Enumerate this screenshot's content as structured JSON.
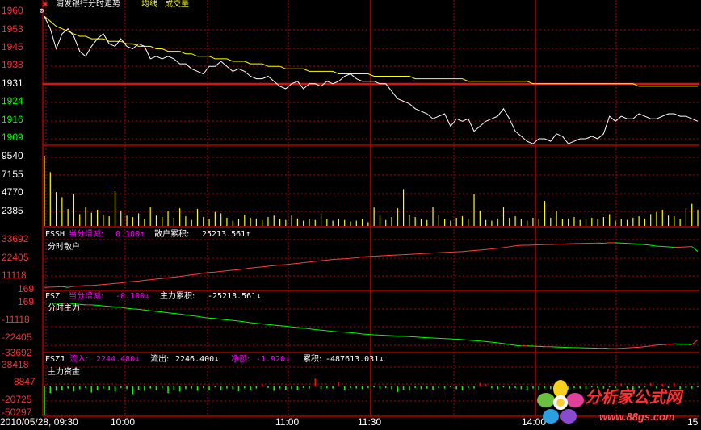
{
  "title_bar": {
    "stock_title": "浦发银行分时走势",
    "legend_avg": "均线",
    "legend_vol": "成交量"
  },
  "price_axis": [
    "1960",
    "1953",
    "1945",
    "1938",
    "1931",
    "1924",
    "1916",
    "1909"
  ],
  "volume_axis": [
    "9540",
    "7155",
    "4770",
    "2385"
  ],
  "panel_fssh": {
    "code": "FSSH",
    "inc_label": "当分增减:",
    "inc_value": "0.100↑",
    "cum_label": "散户累积:",
    "cum_value": "25213.561↑",
    "name": "分时散户",
    "axis": [
      "33692",
      "22405",
      "11118",
      "169"
    ]
  },
  "panel_fszl": {
    "code": "FSZL",
    "inc_label": "当分增减:",
    "inc_value": "-0.100↓",
    "cum_label": "主力累积:",
    "cum_value": "-25213.561↓",
    "name": "分时主力",
    "axis": [
      "169",
      "-11118",
      "-22405",
      "-33692"
    ]
  },
  "panel_fszj": {
    "code": "FSZJ",
    "in_label": "流入:",
    "in_value": "2244.480↓",
    "out_label": "流出:",
    "out_value": "2246.400↓",
    "net_label": "净额:",
    "net_value": "-1.920↓",
    "cum_label": "累积:",
    "cum_value": "-487613.031↓",
    "name": "主力资金",
    "axis": [
      "38418",
      "8847",
      "-20725",
      "-50297"
    ]
  },
  "time_axis": {
    "start": "2010/05/28, 09:30",
    "t1000": "10:00",
    "t1100": "11:00",
    "t1130": "11:30",
    "t1400": "14:00",
    "t1500": "15"
  },
  "watermark": {
    "name": "分析家公式网",
    "url": "www.88gs.com",
    "logo": "flower-logo"
  },
  "colors": {
    "grid": "#b40000",
    "price_line": "#ffffff",
    "avg_line": "#ffff00",
    "volume": "#ffff00",
    "axis_red": "#ff3030",
    "axis_green": "#00ff00",
    "ind_yellow": "#ffff00",
    "ind_magenta": "#ff00ff",
    "ind_white": "#ffffff",
    "ind_green": "#00ff00",
    "net_red": "#ff0000",
    "net_green": "#00ff00"
  },
  "chart_data": [
    {
      "type": "line",
      "name": "price",
      "y_axis_ticks": [
        1960,
        1953,
        1945,
        1938,
        1931,
        1924,
        1916,
        1909
      ],
      "reference_line": 1931,
      "price": [
        1958,
        1953,
        1945,
        1951,
        1953,
        1950,
        1944,
        1942,
        1946,
        1949,
        1951,
        1947,
        1946,
        1949,
        1946,
        1945,
        1947,
        1946,
        1941,
        1942,
        1941,
        1942,
        1941,
        1939,
        1939,
        1937,
        1936,
        1935,
        1938,
        1938,
        1940,
        1938,
        1936,
        1937,
        1936,
        1934,
        1933,
        1933,
        1934,
        1932,
        1930,
        1929,
        1931,
        1932,
        1929,
        1931,
        1931,
        1930,
        1932,
        1931,
        1932,
        1934,
        1935,
        1933,
        1932,
        1932,
        1932,
        1931,
        1931,
        1928,
        1925,
        1924,
        1923,
        1921,
        1920,
        1919,
        1917,
        1918,
        1919,
        1914,
        1917,
        1916,
        1917,
        1912,
        1914,
        1916,
        1917,
        1918,
        1921,
        1917,
        1912,
        1910,
        1908,
        1907,
        1909,
        1909,
        1908,
        1911,
        1910,
        1907,
        1908,
        1909,
        1909,
        1910,
        1909,
        1911,
        1918,
        1916,
        1918,
        1917,
        1917,
        1919,
        1918,
        1917,
        1917,
        1918,
        1919,
        1919,
        1918,
        1918,
        1917,
        1916
      ],
      "average": [
        1958,
        1956,
        1954,
        1953,
        1952,
        1951,
        1950,
        1950,
        1949,
        1949,
        1949,
        1948,
        1948,
        1948,
        1947,
        1947,
        1946,
        1946,
        1946,
        1945,
        1945,
        1944,
        1944,
        1944,
        1943,
        1943,
        1942,
        1942,
        1942,
        1941,
        1941,
        1941,
        1940,
        1940,
        1940,
        1939,
        1939,
        1939,
        1938,
        1938,
        1938,
        1937,
        1937,
        1937,
        1937,
        1936,
        1936,
        1936,
        1936,
        1936,
        1935,
        1935,
        1935,
        1935,
        1935,
        1935,
        1934,
        1934,
        1934,
        1934,
        1934,
        1934,
        1934,
        1933,
        1933,
        1933,
        1933,
        1933,
        1933,
        1933,
        1933,
        1933,
        1932,
        1932,
        1932,
        1932,
        1932,
        1932,
        1932,
        1932,
        1932,
        1932,
        1932,
        1931,
        1931,
        1931,
        1931,
        1931,
        1931,
        1931,
        1931,
        1931,
        1931,
        1931,
        1931,
        1931,
        1931,
        1931,
        1931,
        1931,
        1931,
        1930,
        1930,
        1930,
        1930,
        1930,
        1930,
        1930,
        1930,
        1930,
        1930,
        1930
      ]
    },
    {
      "type": "bar",
      "name": "volume",
      "y_axis_ticks": [
        9540,
        7155,
        4770,
        2385
      ],
      "values": [
        9540,
        7300,
        4600,
        3900,
        2300,
        4400,
        1600,
        2600,
        1800,
        2200,
        1500,
        1300,
        4700,
        2100,
        1400,
        1200,
        1700,
        900,
        2600,
        1400,
        1200,
        2000,
        1100,
        2400,
        1300,
        800,
        2300,
        1200,
        900,
        1900,
        1700,
        1100,
        700,
        900,
        1500,
        1100,
        1000,
        800,
        1200,
        1400,
        900,
        800,
        1400,
        1000,
        700,
        900,
        800,
        1700,
        900,
        700,
        900,
        800,
        600,
        700,
        900,
        500,
        2500,
        1400,
        800,
        1200,
        2400,
        5000,
        1500,
        1200,
        900,
        800,
        2600,
        1500,
        900,
        700,
        1100,
        1300,
        900,
        4300,
        2100,
        800,
        700,
        1000,
        2600,
        1100,
        1300,
        900,
        700,
        1100,
        900,
        3400,
        1100,
        2000,
        900,
        1000,
        1200,
        800,
        1000,
        1100,
        900,
        1200,
        1600,
        700,
        900,
        800,
        1100,
        1300,
        1000,
        1600,
        1900,
        2200,
        1400,
        1300,
        900,
        2400,
        3000,
        2200,
        1400,
        1700,
        2000,
        2300
      ]
    },
    {
      "type": "line",
      "name": "分时散户",
      "y_axis_ticks": [
        33692,
        22405,
        11118,
        169
      ],
      "values": [
        600,
        800,
        900,
        1100,
        600,
        1300,
        1600,
        1900,
        1900,
        2200,
        2600,
        2900,
        3300,
        3600,
        4200,
        4600,
        4900,
        5400,
        5800,
        6300,
        6700,
        7200,
        7600,
        8000,
        8600,
        9200,
        9600,
        10300,
        10800,
        11000,
        11500,
        11900,
        12300,
        12700,
        13200,
        13800,
        14200,
        14600,
        15000,
        15400,
        15800,
        16100,
        16600,
        17000,
        17400,
        17900,
        18400,
        18800,
        19200,
        19600,
        19900,
        20100,
        20400,
        20800,
        21300,
        21600,
        21900,
        22100,
        22300,
        22500,
        22700,
        22900,
        23100,
        23300,
        23600,
        23800,
        24000,
        24200,
        24400,
        24600,
        24800,
        25000,
        25400,
        25700,
        26000,
        26400,
        26800,
        27200,
        27700,
        28300,
        28900,
        29300,
        29300,
        29400,
        29600,
        29800,
        29800,
        30000,
        30100,
        30300,
        30400,
        30500,
        30600,
        30700,
        30800,
        30700,
        31000,
        31000,
        30800,
        30600,
        30300,
        30100,
        29700,
        29300,
        28700,
        28500,
        28200,
        27900,
        28000,
        28200,
        28400,
        25214
      ]
    },
    {
      "type": "line",
      "name": "分时主力",
      "y_axis_ticks": [
        169,
        -11118,
        -22405,
        -33692
      ],
      "values": [
        -600,
        -800,
        -900,
        -1100,
        -600,
        -1300,
        -1600,
        -1900,
        -1900,
        -2200,
        -2600,
        -2900,
        -3300,
        -3600,
        -4200,
        -4600,
        -4900,
        -5400,
        -5800,
        -6300,
        -6700,
        -7200,
        -7600,
        -8000,
        -8600,
        -9200,
        -9600,
        -10300,
        -10800,
        -11000,
        -11500,
        -11900,
        -12300,
        -12700,
        -13200,
        -13800,
        -14200,
        -14600,
        -15000,
        -15400,
        -15800,
        -16100,
        -16600,
        -17000,
        -17400,
        -17900,
        -18400,
        -18800,
        -19200,
        -19600,
        -19900,
        -20100,
        -20400,
        -20800,
        -21300,
        -21600,
        -21900,
        -22100,
        -22300,
        -22500,
        -22700,
        -22900,
        -23100,
        -23300,
        -23600,
        -23800,
        -24000,
        -24200,
        -24400,
        -24600,
        -24800,
        -25000,
        -25400,
        -25700,
        -26000,
        -26400,
        -26800,
        -27200,
        -27700,
        -28300,
        -28900,
        -29300,
        -29300,
        -29400,
        -29600,
        -29800,
        -29800,
        -30000,
        -30100,
        -30300,
        -30400,
        -30500,
        -30600,
        -30700,
        -30800,
        -30700,
        -31000,
        -31000,
        -30800,
        -30600,
        -30300,
        -30100,
        -29700,
        -29300,
        -28700,
        -28500,
        -28200,
        -27900,
        -28000,
        -28200,
        -28400,
        -25214
      ]
    },
    {
      "type": "bar",
      "name": "主力资金",
      "y_axis_ticks": [
        38418,
        8847,
        -20725,
        -50297
      ],
      "values": [
        -50000,
        -12000,
        -8000,
        -6000,
        -4000,
        -9000,
        -5000,
        -3000,
        -11000,
        -7000,
        -4000,
        -6000,
        -9000,
        -3000,
        -5000,
        -14000,
        -6000,
        -8000,
        -4000,
        -7000,
        -3000,
        -12000,
        -6000,
        -9000,
        -5000,
        -4000,
        -8000,
        -3000,
        -6000,
        -2000,
        -7000,
        -4000,
        -5000,
        -9000,
        -3000,
        -6000,
        -4000,
        5000,
        -3000,
        -8000,
        -4000,
        -6000,
        -5000,
        -7000,
        -3000,
        -4000,
        14000,
        -5000,
        -3000,
        -4000,
        8000,
        -6000,
        -3000,
        -4000,
        -5000,
        -3000,
        -2000,
        -4000,
        -3000,
        -5000,
        -10000,
        -6000,
        -7000,
        -3000,
        -5000,
        -4000,
        -6000,
        -3000,
        -4000,
        -2000,
        -5000,
        -7000,
        -3000,
        -4000,
        6000,
        4000,
        -3000,
        -5000,
        -2000,
        -4000,
        -3000,
        -5000,
        -6000,
        -4000,
        -7000,
        -3000,
        -5000,
        -2000,
        -4000,
        -6000,
        -3000,
        -4000,
        -5000,
        -2000,
        -3000,
        -4000,
        -2000,
        -3000,
        5000,
        -4000,
        -6000,
        -3000,
        -2000,
        6000,
        -4000,
        4000,
        -3000,
        6000,
        -5000,
        -3000,
        -4000,
        -2000
      ]
    }
  ]
}
